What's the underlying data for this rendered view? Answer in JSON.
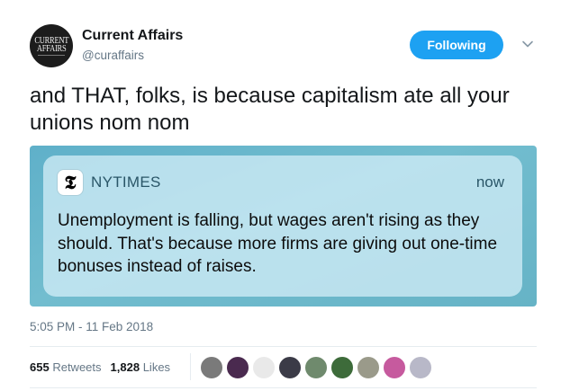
{
  "account": {
    "name": "Current Affairs",
    "handle": "@curaffairs",
    "avatar_line1": "CURRENT",
    "avatar_line2": "AFFAIRS"
  },
  "follow_button": {
    "label": "Following"
  },
  "tweet": {
    "text": "and THAT, folks, is because capitalism ate all your unions nom nom",
    "timestamp": "5:05 PM - 11 Feb 2018"
  },
  "notification": {
    "app_icon_glyph": "𝕿",
    "app_name": "NYTIMES",
    "time": "now",
    "body": "Unemployment is falling, but wages aren't rising as they should. That's because more firms are giving out one-time bonuses instead of raises."
  },
  "stats": {
    "retweets_count": "655",
    "retweets_label": "Retweets",
    "likes_count": "1,828",
    "likes_label": "Likes"
  },
  "likers": [
    {
      "color": "#7a7a7a"
    },
    {
      "color": "#4a2a4f"
    },
    {
      "color": "#e9e9e9"
    },
    {
      "color": "#3b3b47"
    },
    {
      "color": "#6f8a6d"
    },
    {
      "color": "#3d6b3a"
    },
    {
      "color": "#9a9a8a"
    },
    {
      "color": "#c65a9e"
    },
    {
      "color": "#b8b8c8"
    }
  ],
  "colors": {
    "accent": "#1da1f2",
    "secondary_text": "#657786",
    "media_bg": "#66b3c6"
  }
}
